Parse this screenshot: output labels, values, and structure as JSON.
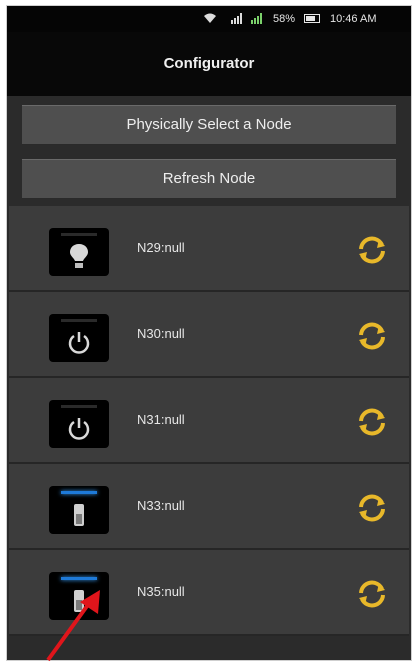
{
  "status": {
    "percent": "58%",
    "time": "10:46 AM"
  },
  "title": "Configurator",
  "buttons": {
    "select": "Physically Select a Node",
    "refresh": "Refresh Node"
  },
  "nodes": [
    {
      "label": "N29:null",
      "icon": "bulb-icon"
    },
    {
      "label": "N30:null",
      "icon": "power-icon"
    },
    {
      "label": "N31:null",
      "icon": "power-icon"
    },
    {
      "label": "N33:null",
      "icon": "switch-icon"
    },
    {
      "label": "N35:null",
      "icon": "switch-icon"
    }
  ],
  "colors": {
    "accent": "#e8b82a",
    "arrow": "#e0151b",
    "indicator": "#1e7ad8"
  }
}
